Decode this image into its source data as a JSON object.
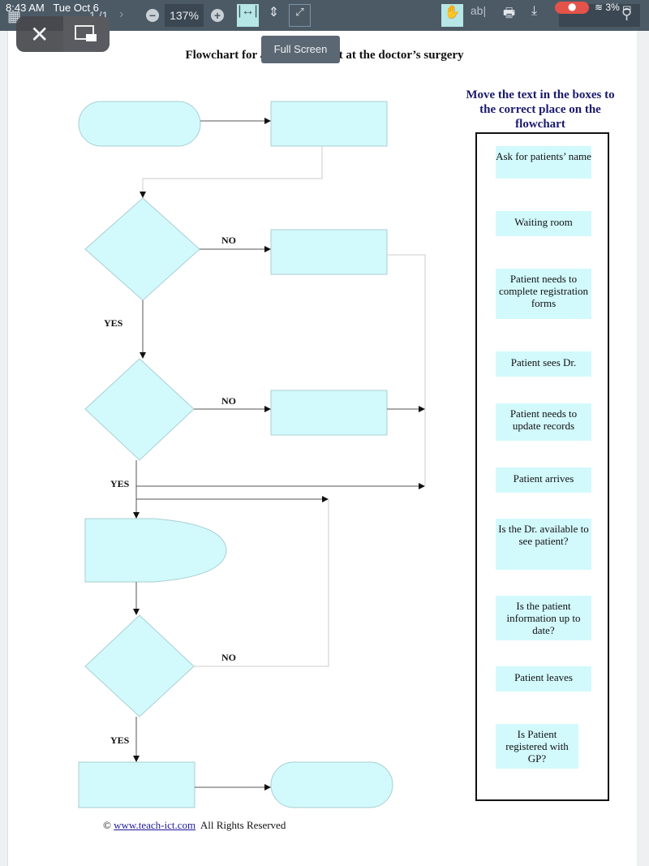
{
  "status_bar": {
    "time": "8:43 AM",
    "date": "Tue Oct 6",
    "battery": "3%",
    "icons": [
      "microphone-icon",
      "wifi-icon",
      "battery-charging-icon"
    ]
  },
  "toolbar": {
    "page_indicator": "1 /1",
    "zoom_level": "137%",
    "zoom_out_label": "−",
    "zoom_in_label": "+",
    "tools": [
      "fit-width",
      "fit-height",
      "full-screen",
      "hand",
      "text-select",
      "print",
      "download",
      "search"
    ],
    "text_select_label": "ab|"
  },
  "overlay": {
    "close_label": "✕",
    "pip_label": "picture-in-picture"
  },
  "tooltip": {
    "text": "Full Screen"
  },
  "document": {
    "title_left": "Flowchart for a",
    "title_right": "t at the doctor’s surgery",
    "labels": {
      "no1": "NO",
      "yes1": "YES",
      "no2": "NO",
      "yes2": "YES",
      "no3": "NO",
      "yes3": "YES"
    },
    "panel": {
      "title": "Move the text in the boxes to the correct place on the flowchart",
      "cards": [
        "Ask for patients’ name",
        "Waiting room",
        "Patient needs to complete registration forms",
        "Patient sees Dr.",
        "Patient needs to update records",
        "Patient arrives",
        "Is the Dr. available to see patient?",
        "Is the patient information up to date?",
        "Patient leaves",
        "Is Patient registered with GP?"
      ]
    },
    "footer": {
      "copyright": "©",
      "link_text": "www.teach-ict.com",
      "rights": "All Rights Reserved"
    },
    "colors": {
      "shape_fill": "#d2f9fc",
      "shape_stroke": "#a9cfd2",
      "panel_title": "#1b1a6e",
      "link": "#1c1a9c"
    }
  }
}
